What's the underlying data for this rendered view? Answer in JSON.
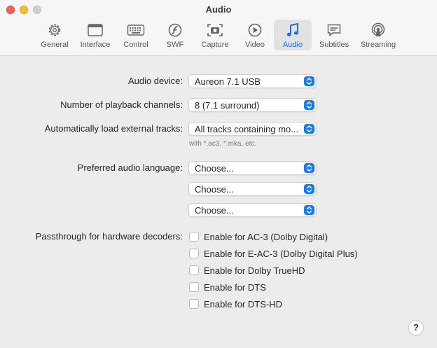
{
  "window": {
    "title": "Audio"
  },
  "toolbar": {
    "tabs": [
      {
        "label": "General",
        "icon": "gear-icon"
      },
      {
        "label": "Interface",
        "icon": "window-icon"
      },
      {
        "label": "Control",
        "icon": "keyboard-icon"
      },
      {
        "label": "SWF",
        "icon": "flash-icon"
      },
      {
        "label": "Capture",
        "icon": "camera-icon"
      },
      {
        "label": "Video",
        "icon": "play-icon"
      },
      {
        "label": "Audio",
        "icon": "music-note-icon",
        "active": true
      },
      {
        "label": "Subtitles",
        "icon": "subtitles-icon"
      },
      {
        "label": "Streaming",
        "icon": "broadcast-icon"
      }
    ],
    "accent_color": "#1a6ee8"
  },
  "audio": {
    "device_label": "Audio device:",
    "device_value": "Aureon 7.1 USB",
    "channels_label": "Number of playback channels:",
    "channels_value": "8 (7.1 surround)",
    "external_label": "Automatically load external tracks:",
    "external_value": "All tracks containing mo...",
    "external_hint": "with *.ac3, *.mka, etc.",
    "language_label": "Preferred audio language:",
    "language_values": [
      "Choose...",
      "Choose...",
      "Choose..."
    ],
    "passthrough_label": "Passthrough for hardware decoders:",
    "passthrough": [
      {
        "label": "Enable for AC-3 (Dolby Digital)",
        "checked": false
      },
      {
        "label": "Enable for E-AC-3 (Dolby Digital Plus)",
        "checked": false
      },
      {
        "label": "Enable for Dolby TrueHD",
        "checked": false
      },
      {
        "label": "Enable for DTS",
        "checked": false
      },
      {
        "label": "Enable for DTS-HD",
        "checked": false
      }
    ]
  },
  "help": {
    "label": "?"
  }
}
